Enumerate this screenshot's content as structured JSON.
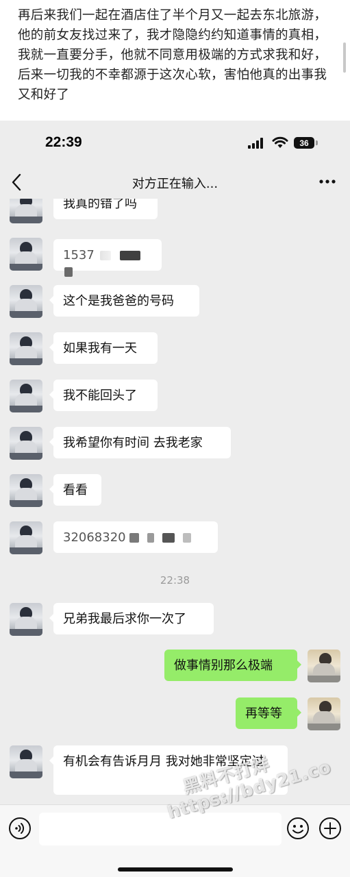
{
  "caption": {
    "text": "再后来我们一起在酒店住了半个月又一起去东北旅游，他的前女友找过来了，我才隐隐约约知道事情的真相，我就一直要分手，他就不同意用极端的方式求我和好，后来一切我的不幸都源于这次心软，害怕他真的出事我又和好了"
  },
  "status_bar": {
    "time": "22:39",
    "battery": "36",
    "icons": [
      "cellular-signal-icon",
      "wifi-icon",
      "battery-icon"
    ]
  },
  "nav": {
    "title": "对方正在输入...",
    "back_icon": "chevron-left-icon",
    "more_icon": "more-dots-icon"
  },
  "messages": [
    {
      "from": "other",
      "text": "我真的错了吗"
    },
    {
      "from": "other",
      "text": "1537",
      "redacted": true
    },
    {
      "from": "other",
      "text": "这个是我爸爸的号码"
    },
    {
      "from": "other",
      "text": "如果我有一天"
    },
    {
      "from": "other",
      "text": "我不能回头了"
    },
    {
      "from": "other",
      "text": "我希望你有时间 去我老家"
    },
    {
      "from": "other",
      "text": "看看"
    },
    {
      "from": "other",
      "text": "32068320",
      "redacted": true
    },
    {
      "from": "other",
      "text": "兄弟我最后求你一次了"
    },
    {
      "from": "me",
      "text": "做事情别那么极端"
    },
    {
      "from": "me",
      "text": "再等等"
    },
    {
      "from": "other",
      "text": "有机会有告诉月月 我对她非常坚定过"
    }
  ],
  "timestamp": "22:38",
  "input_bar": {
    "icons": [
      "voice-icon",
      "emoji-icon",
      "plus-icon"
    ]
  },
  "watermark": {
    "line1": "黑料不打烊",
    "line2": "https://bdy21.co"
  },
  "colors": {
    "chat_background": "#ededed",
    "my_bubble": "#95ec69",
    "their_bubble": "#ffffff"
  }
}
